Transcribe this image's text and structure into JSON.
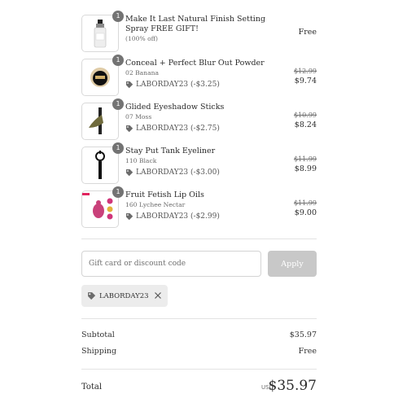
{
  "items": [
    {
      "quantity": "1",
      "title": "Make It Last Natural Finish Setting Spray FREE GIFT!",
      "variant": "(100% off)",
      "discount": "",
      "old_price": "",
      "price": "Free"
    },
    {
      "quantity": "1",
      "title": "Conceal + Perfect Blur Out Powder",
      "variant": "02 Banana",
      "discount": "LABORDAY23 (-$3.25)",
      "old_price": "$12.99",
      "price": "$9.74"
    },
    {
      "quantity": "1",
      "title": "Glided Eyeshadow Sticks",
      "variant": "07 Moss",
      "discount": "LABORDAY23 (-$2.75)",
      "old_price": "$10.99",
      "price": "$8.24"
    },
    {
      "quantity": "1",
      "title": "Stay Put Tank Eyeliner",
      "variant": "110 Black",
      "discount": "LABORDAY23 (-$3.00)",
      "old_price": "$11.99",
      "price": "$8.99"
    },
    {
      "quantity": "1",
      "title": "Fruit Fetish Lip Oils",
      "variant": "160 Lychee Nectar",
      "discount": "LABORDAY23 (-$2.99)",
      "old_price": "$11.99",
      "price": "$9.00"
    }
  ],
  "discount_form": {
    "placeholder": "Gift card or discount code",
    "value": "",
    "apply_label": "Apply"
  },
  "applied_code": {
    "code": "LABORDAY23"
  },
  "summary": {
    "subtotal_label": "Subtotal",
    "subtotal_value": "$35.97",
    "shipping_label": "Shipping",
    "shipping_value": "Free",
    "total_label": "Total",
    "currency": "USD",
    "total_value": "$35.97"
  },
  "icons": {
    "discount_tag": "tag-icon",
    "remove_code": "close-icon"
  },
  "colors": {
    "quantity_badge": "#737373",
    "apply_disabled": "#c8c8c8",
    "chip_bg": "#ececec"
  }
}
